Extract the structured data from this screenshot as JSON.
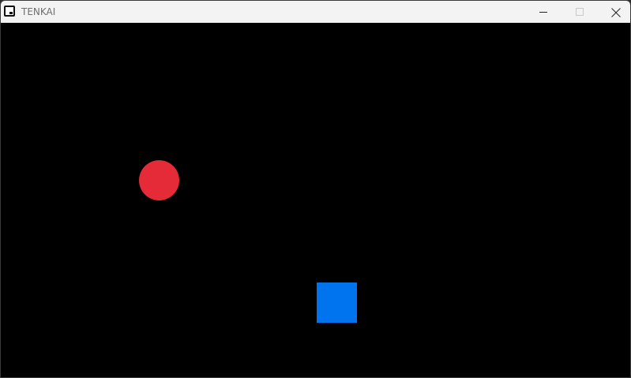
{
  "window": {
    "title": "TENKAI"
  },
  "titlebar_buttons": {
    "minimize_icon": "minimize-icon",
    "maximize_icon": "maximize-icon",
    "close_icon": "close-icon"
  },
  "scene": {
    "background_color": "#000000",
    "ball": {
      "shape": "circle",
      "color": "#e52a38"
    },
    "block": {
      "shape": "square",
      "color": "#0074ee"
    }
  }
}
